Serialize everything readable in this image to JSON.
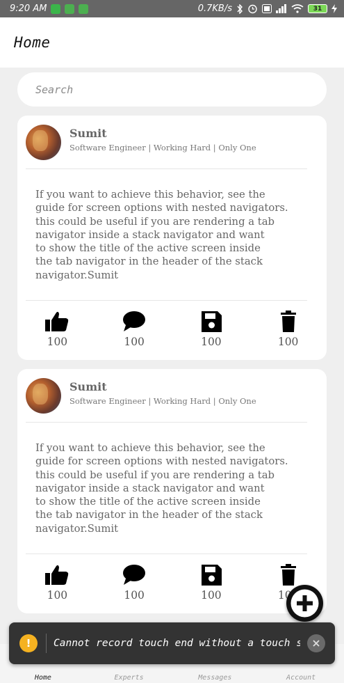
{
  "status_bar": {
    "time": "9:20 AM",
    "net_speed": "0.7KB/s",
    "battery": "31"
  },
  "header": {
    "title": "Home"
  },
  "search": {
    "placeholder": "Search",
    "value": ""
  },
  "posts": [
    {
      "author": "Sumit",
      "role": "Software Engineer  |  Working Hard  |  Only One",
      "body": "If you want to achieve this behavior, see the\nguide for screen options with nested navigators.\nthis could be useful if you are rendering a tab\nnavigator inside a stack navigator and want\nto show the title of the active screen inside\nthe tab navigator in the header of the stack\nnavigator.Sumit",
      "actions": {
        "like": "100",
        "comment": "100",
        "save": "100",
        "delete": "100"
      }
    },
    {
      "author": "Sumit",
      "role": "Software Engineer  |  Working Hard  |  Only One",
      "body": "If you want to achieve this behavior, see the\nguide for screen options with nested navigators.\nthis could be useful if you are rendering a tab\nnavigator inside a stack navigator and want\nto show the title of the active screen inside\nthe tab navigator in the header of the stack\nnavigator.Sumit",
      "actions": {
        "like": "100",
        "comment": "100",
        "save": "100",
        "delete": "100"
      }
    }
  ],
  "bottom_nav": [
    {
      "label": "Home",
      "icon": "home-icon",
      "active": true
    },
    {
      "label": "Experts",
      "icon": "experts-icon",
      "active": false
    },
    {
      "label": "Messages",
      "icon": "messages-icon",
      "active": false
    },
    {
      "label": "Account",
      "icon": "account-icon",
      "active": false
    }
  ],
  "toast": {
    "icon": "warning-icon",
    "message": "Cannot record touch end without a touch start..."
  },
  "fab": {
    "icon": "plus-icon"
  },
  "colors": {
    "status_bar": "#666666",
    "background": "#efefef",
    "card": "#ffffff",
    "fab": "#111111",
    "toast_bg": "#333333",
    "toast_warn": "#f5b221"
  }
}
